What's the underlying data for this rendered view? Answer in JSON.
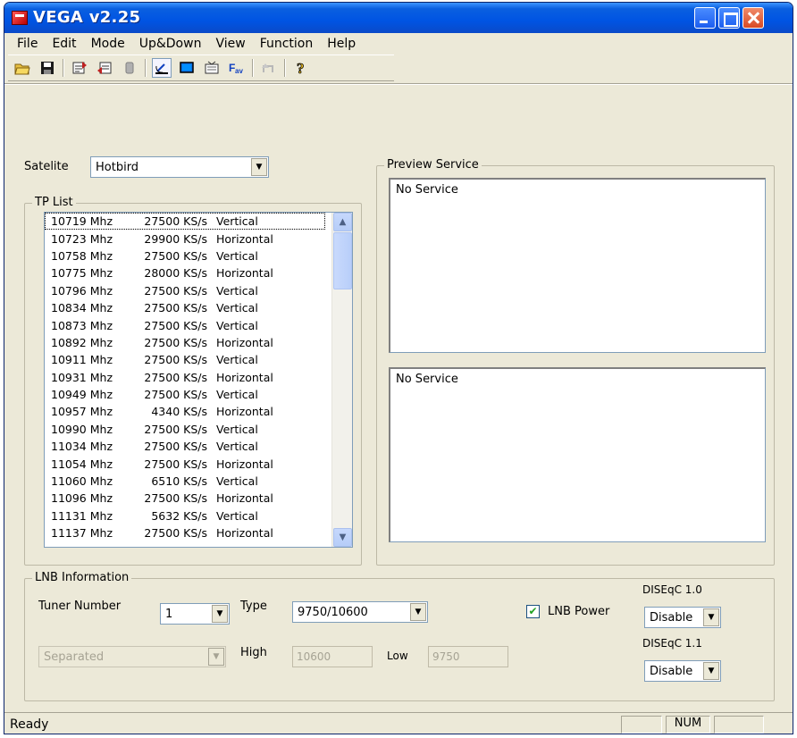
{
  "window": {
    "title": "VEGA v2.25"
  },
  "menu": [
    "File",
    "Edit",
    "Mode",
    "Up&Down",
    "View",
    "Function",
    "Help"
  ],
  "satellite": {
    "label": "Satelite",
    "value": "Hotbird"
  },
  "tp_list": {
    "label": "TP List",
    "rows": [
      [
        "10719 Mhz",
        "27500 KS/s",
        "Vertical"
      ],
      [
        "10723 Mhz",
        "29900 KS/s",
        "Horizontal"
      ],
      [
        "10758 Mhz",
        "27500 KS/s",
        "Vertical"
      ],
      [
        "10775 Mhz",
        "28000 KS/s",
        "Horizontal"
      ],
      [
        "10796 Mhz",
        "27500 KS/s",
        "Vertical"
      ],
      [
        "10834 Mhz",
        "27500 KS/s",
        "Vertical"
      ],
      [
        "10873 Mhz",
        "27500 KS/s",
        "Vertical"
      ],
      [
        "10892 Mhz",
        "27500 KS/s",
        "Horizontal"
      ],
      [
        "10911 Mhz",
        "27500 KS/s",
        "Vertical"
      ],
      [
        "10931 Mhz",
        "27500 KS/s",
        "Horizontal"
      ],
      [
        "10949 Mhz",
        "27500 KS/s",
        "Vertical"
      ],
      [
        "10957 Mhz",
        "4340 KS/s",
        "Horizontal"
      ],
      [
        "10990 Mhz",
        "27500 KS/s",
        "Vertical"
      ],
      [
        "11034 Mhz",
        "27500 KS/s",
        "Vertical"
      ],
      [
        "11054 Mhz",
        "27500 KS/s",
        "Horizontal"
      ],
      [
        "11060 Mhz",
        "6510 KS/s",
        "Vertical"
      ],
      [
        "11096 Mhz",
        "27500 KS/s",
        "Horizontal"
      ],
      [
        "11131 Mhz",
        "5632 KS/s",
        "Vertical"
      ],
      [
        "11137 Mhz",
        "27500 KS/s",
        "Horizontal"
      ]
    ]
  },
  "preview": {
    "label": "Preview Service",
    "top_text": "No Service",
    "bottom_text": "No Service"
  },
  "lnb": {
    "label": "LNB Information",
    "tuner_label": "Tuner Number",
    "tuner_value": "1",
    "type_label": "Type",
    "type_value": "9750/10600",
    "lnb_power_label": "LNB Power",
    "lnb_power_checked": true,
    "mode_value": "Separated",
    "high_label": "High",
    "high_value": "10600",
    "low_label": "Low",
    "low_value": "9750",
    "diseqc10_label": "DISEqC 1.0",
    "diseqc10_value": "Disable",
    "diseqc11_label": "DISEqC 1.1",
    "diseqc11_value": "Disable"
  },
  "status": {
    "text": "Ready",
    "num": "NUM"
  }
}
